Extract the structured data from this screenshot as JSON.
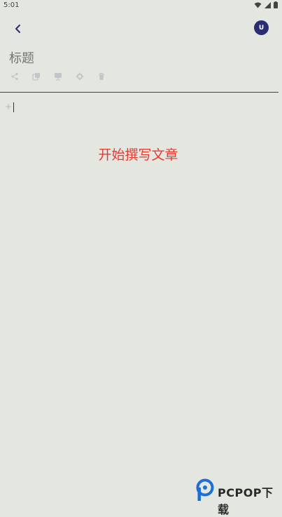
{
  "status_bar": {
    "time": "5:01"
  },
  "header": {
    "avatar_initial": "U"
  },
  "editor": {
    "title_placeholder": "标题",
    "add_block_glyph": "+"
  },
  "hint": {
    "text": "开始撰写文章"
  },
  "watermark": {
    "brand": "PCPOP下载"
  },
  "colors": {
    "accent": "#2b2d72",
    "hint": "#e6392f",
    "background": "#e4e6e0"
  }
}
